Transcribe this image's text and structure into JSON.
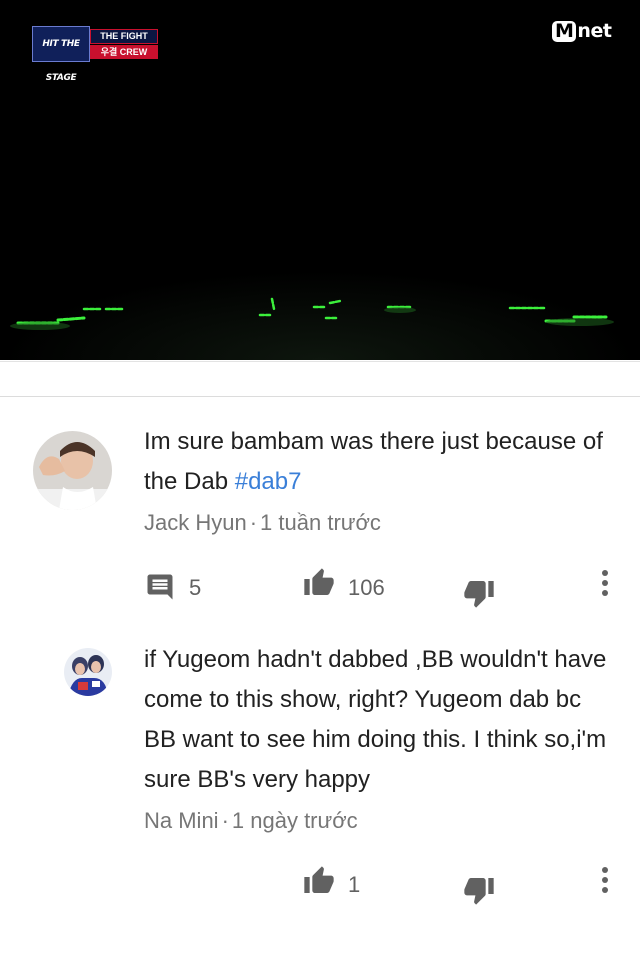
{
  "video": {
    "show_logo": {
      "line1": "HIT THE STAGE",
      "line2": "THE FIGHT",
      "line3": "우결 CREW"
    },
    "channel_logo": {
      "m": "M",
      "rest": "net"
    }
  },
  "comment": {
    "author": "Jack Hyun",
    "time": "1 tuần trước",
    "text_before": "Im sure bambam was there just because of the Dab ",
    "hashtag": "#dab7",
    "reply_count": "5",
    "like_count": "106"
  },
  "reply": {
    "author": "Na Mini",
    "time": "1 ngày trước",
    "text": "if Yugeom hadn't dabbed ,BB wouldn't have come to this show, right? Yugeom dab bc BB want  to see him doing this. I think so,i'm sure BB's very happy",
    "like_count": "1"
  },
  "colors": {
    "hashtag": "#3a7fd8",
    "meta": "#767676",
    "icon": "#616161",
    "glowstick": "#3cf03c"
  },
  "icons": [
    "comment-icon",
    "thumbs-up-icon",
    "thumbs-down-icon",
    "more-vert-icon"
  ]
}
